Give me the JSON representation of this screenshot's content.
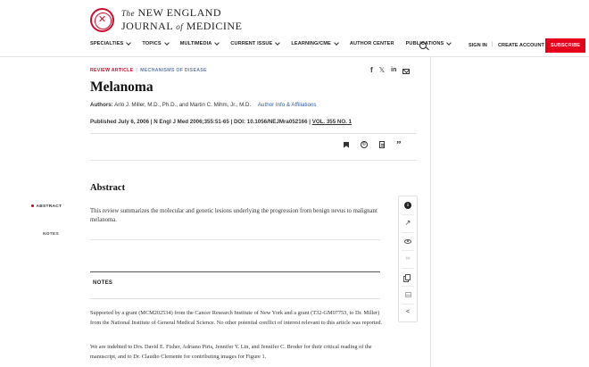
{
  "header": {
    "logo": {
      "the": "The",
      "new_england": "NEW ENGLAND",
      "journal": "JOURNAL",
      "of": "of",
      "medicine": "MEDICINE"
    },
    "nav": [
      {
        "label": "SPECIALTIES",
        "has_dropdown": true
      },
      {
        "label": "TOPICS",
        "has_dropdown": true
      },
      {
        "label": "MULTIMEDIA",
        "has_dropdown": true
      },
      {
        "label": "CURRENT ISSUE",
        "has_dropdown": true
      },
      {
        "label": "LEARNING/CME",
        "has_dropdown": true
      },
      {
        "label": "AUTHOR CENTER",
        "has_dropdown": false
      },
      {
        "label": "PUBLICATIONS",
        "has_dropdown": true
      }
    ],
    "search_icon": "search-icon",
    "sign_in": "SIGN IN",
    "separator": "|",
    "create_account": "CREATE ACCOUNT",
    "subscribe": "SUBSCRIBE"
  },
  "colors": {
    "brand_red": "#c8102e",
    "subscribe_bg": "#e5001c",
    "link_blue": "#2f5fa8",
    "section_blue": "#6a7fa4"
  },
  "article": {
    "section_type": "REVIEW ARTICLE",
    "section_sep": "|",
    "section_series": "MECHANISMS OF DISEASE",
    "share_icons": [
      "facebook-icon",
      "x-icon",
      "linkedin-icon",
      "email-icon"
    ],
    "share_labels": {
      "facebook": "f",
      "x": "𝕏",
      "linkedin": "in"
    },
    "title": "Melanoma",
    "authors_label": "Authors:",
    "authors": "Arlo J. Miller, M.D., Ph.D., and Martin C. Mihm, Jr., M.D.",
    "author_info_link": "Author Info & Affiliations",
    "published": "Published July 6, 2006 | N Engl J Med 2006;355:51-65 | DOI: 10.1056/NEJMra052166 | ",
    "volume": "VOL. 355 NO. 1",
    "tools": [
      "bookmark-icon",
      "cc-icon",
      "document-icon",
      "quote-icon"
    ],
    "cc_label": "©",
    "quote_label": "”",
    "abstract_heading": "Abstract",
    "abstract_text": "This review summarizes the molecular and genetic lesions underlying the progression from benign nevus to malignant melanoma.",
    "notes_heading": "NOTES",
    "note1": "Supported by a grant (MCM202534) from the Cancer Research Institute of New York and a grant (T32-GM07753, to Dr. Miller) from the National Institute of General Medical Science. No other potential conflict of interest relevant to this article was reported.",
    "note2": "We are indebted to Drs. David E. Fisher, Adriano Piris, Jennifer Y. Lin, and Jennifer C. Broder for their critical reading of the manuscript, and to Dr. Claudio Clemente for contributing images for Figure 1."
  },
  "outline": {
    "items": [
      {
        "label": "ABSTRACT",
        "active": true
      },
      {
        "label": "NOTES",
        "active": false
      }
    ]
  },
  "rail": {
    "icons": [
      "info-icon",
      "trend-icon",
      "eye-icon",
      "link-icon",
      "copy-icon",
      "table-icon",
      "share-icon"
    ],
    "info_label": "i",
    "trend_label": "↗",
    "link_label": "🔗",
    "share_label": "<"
  }
}
